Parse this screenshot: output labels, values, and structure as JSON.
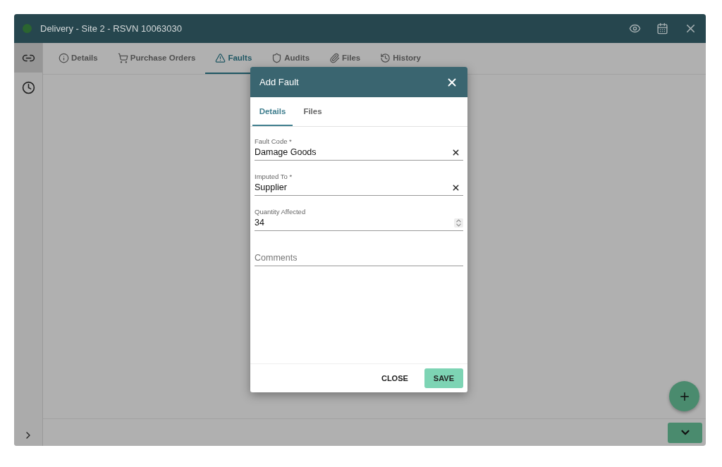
{
  "window": {
    "title": "Delivery - Site 2 - RSVN 10063030"
  },
  "tabs": [
    {
      "label": "Details",
      "selected": false
    },
    {
      "label": "Purchase Orders",
      "selected": false
    },
    {
      "label": "Faults",
      "selected": true
    },
    {
      "label": "Audits",
      "selected": false
    },
    {
      "label": "Files",
      "selected": false
    },
    {
      "label": "History",
      "selected": false
    }
  ],
  "sidebar": {
    "items": [
      {
        "selected": true
      },
      {
        "selected": false
      }
    ]
  },
  "dialog": {
    "title": "Add Fault",
    "tabs": [
      {
        "label": "Details",
        "selected": true
      },
      {
        "label": "Files",
        "selected": false
      }
    ],
    "fields": [
      {
        "kind": "select",
        "label": "Fault Code *",
        "value": "Damage Goods"
      },
      {
        "kind": "select",
        "label": "Imputed To *",
        "value": "Supplier"
      },
      {
        "kind": "number",
        "label": "Quantity Affected",
        "value": "34"
      },
      {
        "kind": "text",
        "placeholder": "Comments"
      }
    ],
    "buttons": [
      {
        "kind": "text",
        "label": "CLOSE"
      },
      {
        "kind": "primary",
        "label": "SAVE"
      }
    ]
  }
}
